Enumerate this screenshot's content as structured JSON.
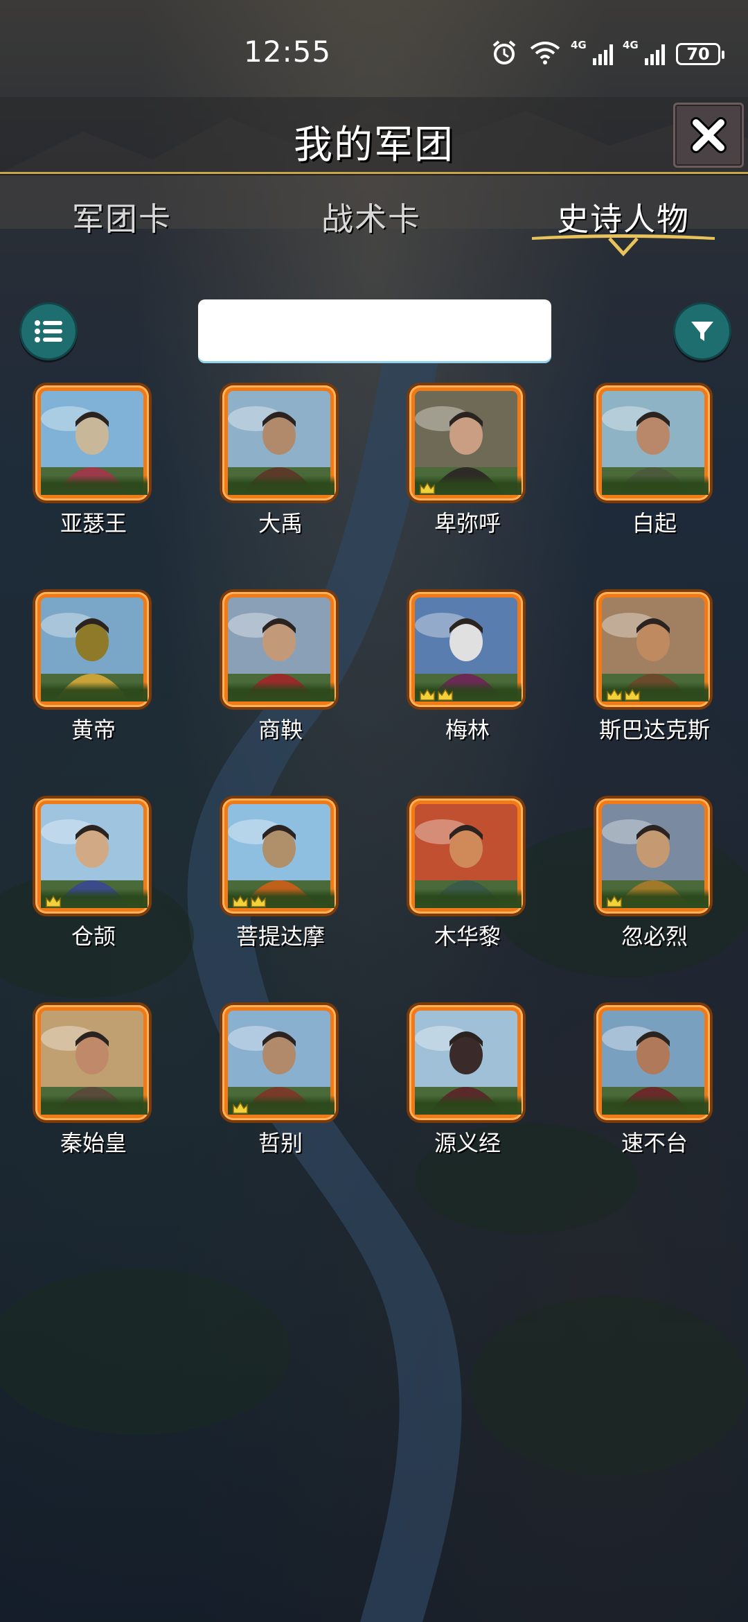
{
  "status_bar": {
    "time": "12:55",
    "network_1": "4G",
    "network_2": "4G",
    "battery": "70"
  },
  "header": {
    "title": "我的军团"
  },
  "tabs": [
    {
      "label": "军团卡",
      "active": false
    },
    {
      "label": "战术卡",
      "active": false
    },
    {
      "label": "史诗人物",
      "active": true
    }
  ],
  "search": {
    "value": "",
    "placeholder": ""
  },
  "colors": {
    "card_frame": "#f07a17",
    "round_button": "#1f6e6f",
    "accent_gold": "#c9a64a"
  },
  "heroes": [
    {
      "name": "亚瑟王",
      "crowns": 0
    },
    {
      "name": "大禹",
      "crowns": 0
    },
    {
      "name": "卑弥呼",
      "crowns": 1
    },
    {
      "name": "白起",
      "crowns": 0
    },
    {
      "name": "黄帝",
      "crowns": 0
    },
    {
      "name": "商鞅",
      "crowns": 0
    },
    {
      "name": "梅林",
      "crowns": 2
    },
    {
      "name": "斯巴达克斯",
      "crowns": 2
    },
    {
      "name": "仓颉",
      "crowns": 1
    },
    {
      "name": "菩提达摩",
      "crowns": 2
    },
    {
      "name": "木华黎",
      "crowns": 0
    },
    {
      "name": "忽必烈",
      "crowns": 1
    },
    {
      "name": "秦始皇",
      "crowns": 0
    },
    {
      "name": "哲别",
      "crowns": 1
    },
    {
      "name": "源义经",
      "crowns": 0
    },
    {
      "name": "速不台",
      "crowns": 0
    }
  ]
}
